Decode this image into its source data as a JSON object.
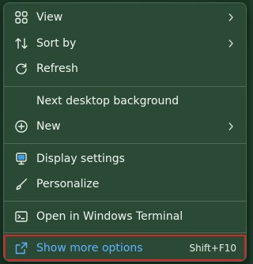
{
  "context_menu": {
    "items": {
      "view": {
        "label": "View",
        "icon": "grid-icon",
        "has_submenu": true
      },
      "sort_by": {
        "label": "Sort by",
        "icon": "sort-arrows-icon",
        "has_submenu": true
      },
      "refresh": {
        "label": "Refresh",
        "icon": "refresh-icon"
      },
      "next_background": {
        "label": "Next desktop background"
      },
      "new": {
        "label": "New",
        "icon": "add-circle-icon",
        "has_submenu": true
      },
      "display_settings": {
        "label": "Display settings",
        "icon": "display-icon"
      },
      "personalize": {
        "label": "Personalize",
        "icon": "brush-icon"
      },
      "terminal": {
        "label": "Open in Windows Terminal",
        "icon": "terminal-icon"
      },
      "show_more": {
        "label": "Show more options",
        "shortcut": "Shift+F10",
        "icon": "open-external-icon"
      }
    }
  },
  "colors": {
    "menu_bg": "#2b4a36",
    "text": "#f2f5f2",
    "highlight_text": "#5fb4ff",
    "highlight_border": "#d42424"
  }
}
